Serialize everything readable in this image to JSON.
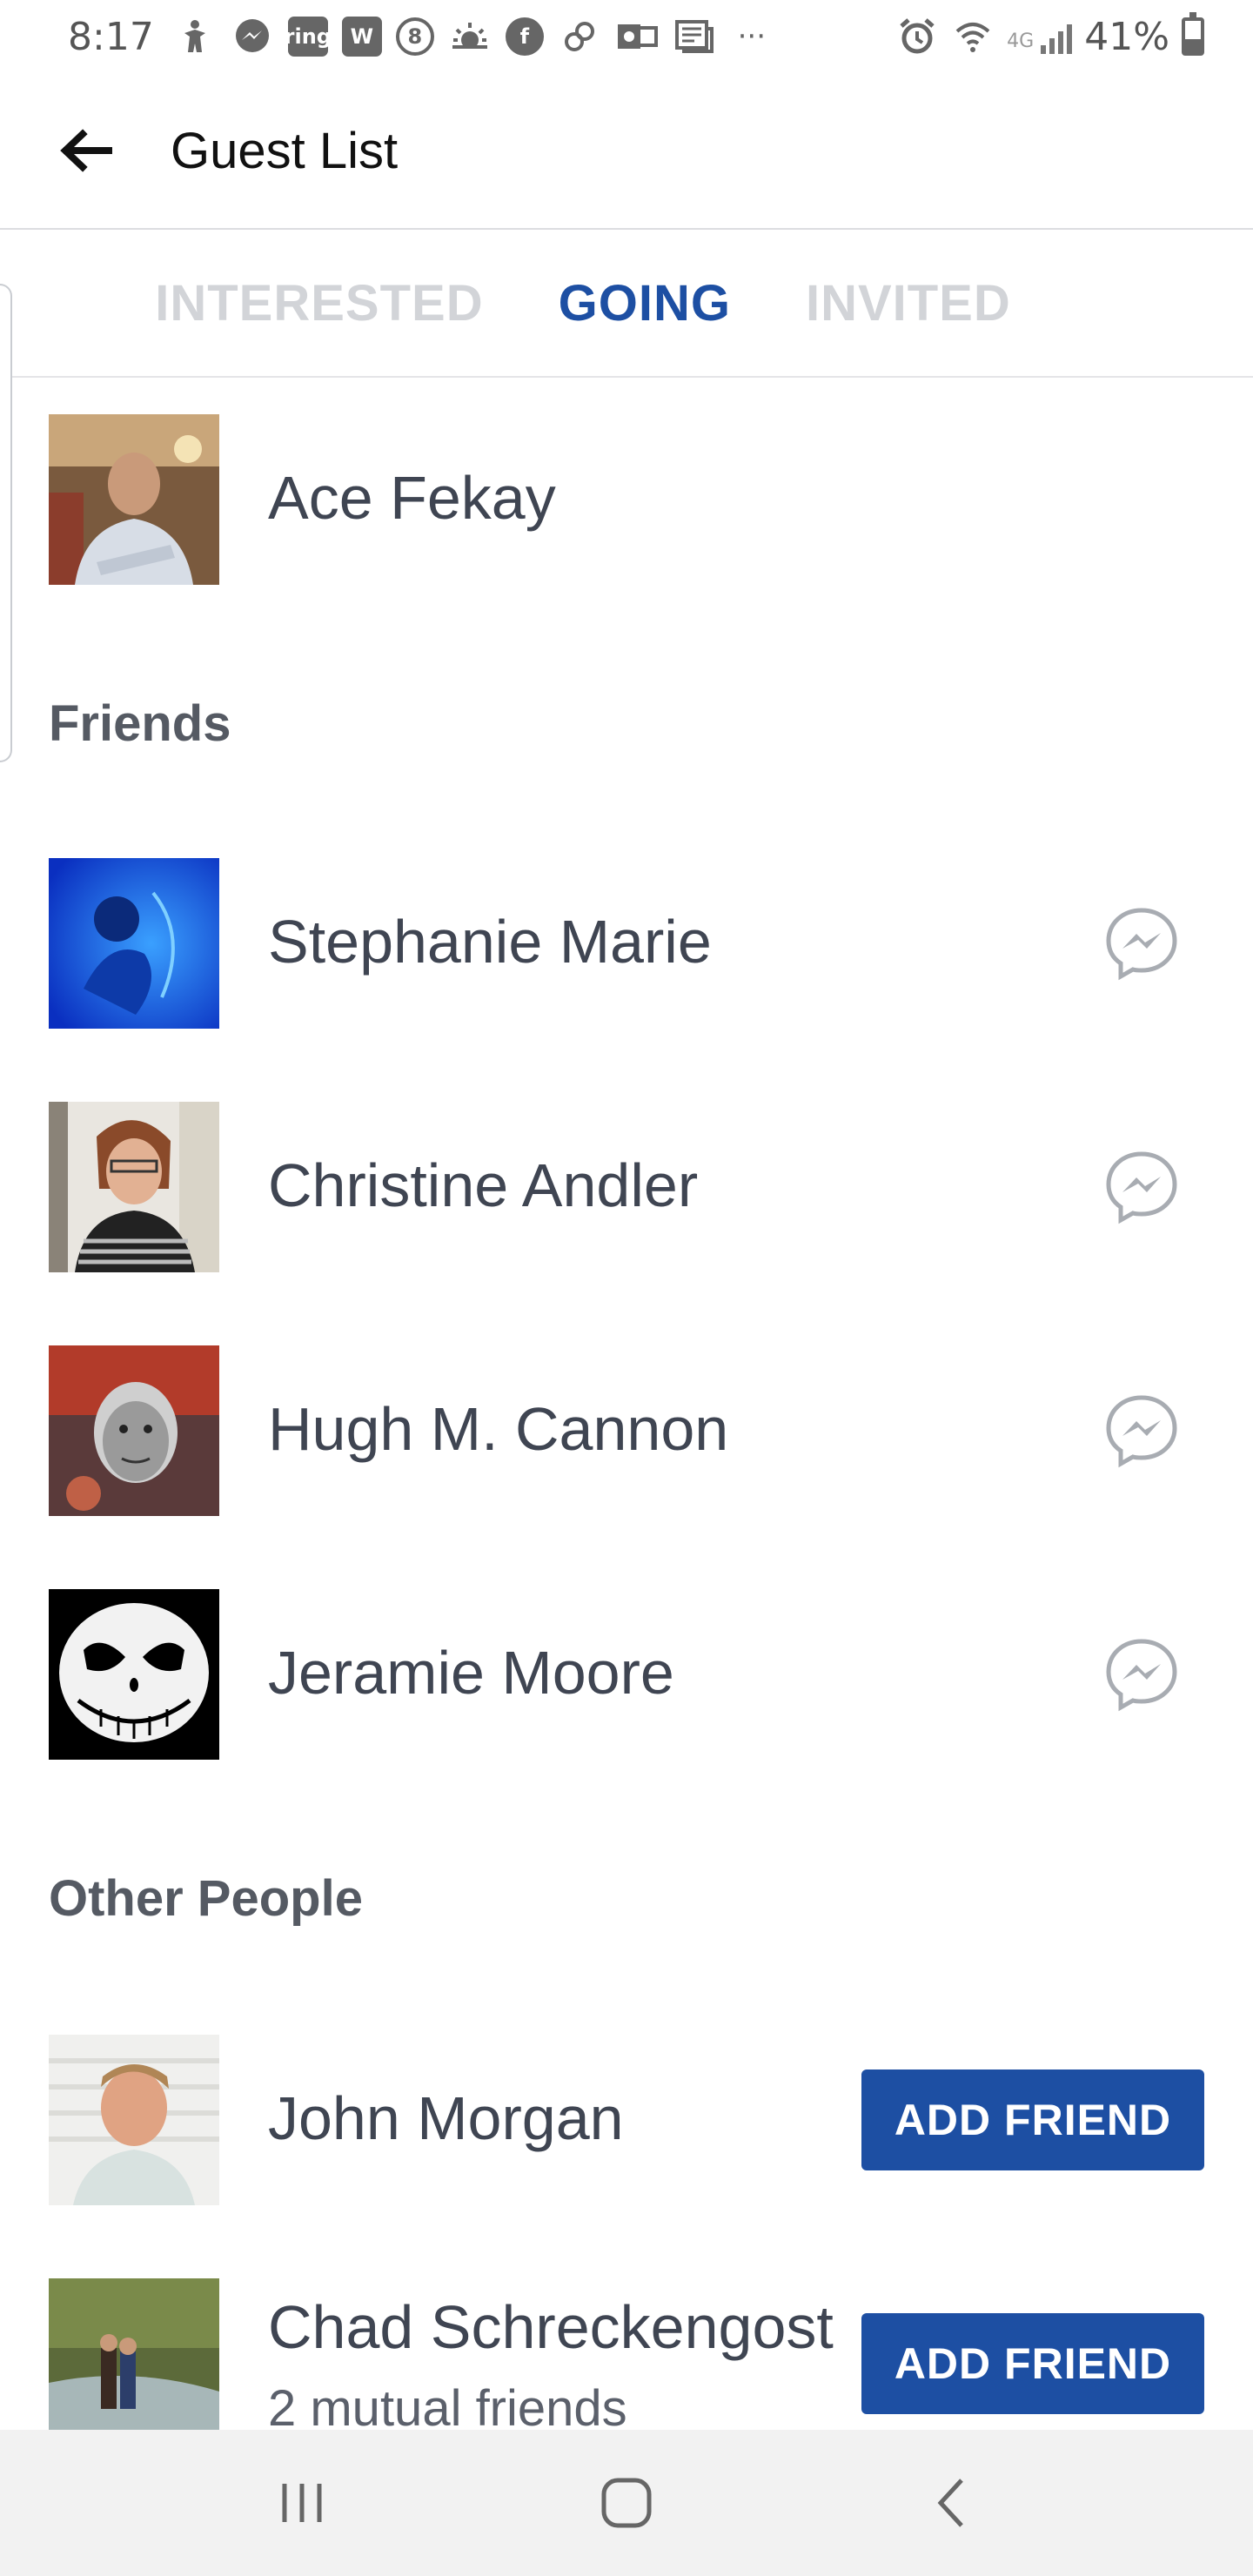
{
  "status_bar": {
    "time": "8:17",
    "icons": [
      "accessibility-icon",
      "messenger-icon",
      "ring-icon",
      "w-app-icon",
      "8-ball-icon",
      "weather-icon",
      "facebook-icon",
      "link-icon",
      "outlook-icon",
      "news-icon",
      "more-dots-icon"
    ],
    "ring_label": "ring",
    "w_label": "W",
    "eight_label": "8",
    "f_label": "f",
    "dots_label": "···",
    "network": "4G",
    "battery": "41%"
  },
  "app_bar": {
    "title": "Guest List",
    "back_icon": "back-arrow-icon"
  },
  "tabs": [
    {
      "label": "INTERESTED",
      "active": false
    },
    {
      "label": "GOING",
      "active": true
    },
    {
      "label": "INVITED",
      "active": false
    }
  ],
  "host": {
    "name": "Ace Fekay"
  },
  "friends_section": {
    "label": "Friends",
    "people": [
      {
        "name": "Stephanie Marie",
        "action_icon": "messenger-icon"
      },
      {
        "name": "Christine Andler",
        "action_icon": "messenger-icon"
      },
      {
        "name": "Hugh M. Cannon",
        "action_icon": "messenger-icon"
      },
      {
        "name": "Jeramie Moore",
        "action_icon": "messenger-icon"
      }
    ]
  },
  "other_section": {
    "label": "Other People",
    "people": [
      {
        "name": "John Morgan",
        "subtitle": "",
        "action_label": "ADD FRIEND"
      },
      {
        "name": "Chad Schreckengost",
        "subtitle": "2 mutual friends",
        "action_label": "ADD FRIEND"
      }
    ]
  },
  "colors": {
    "accent": "#1d4fa3",
    "tab_inactive": "#d2d4d8",
    "text": "#3f4552",
    "nav_bg": "#f2f2f2"
  },
  "nav_bar": {
    "buttons": [
      "recent-apps-icon",
      "home-icon",
      "back-icon"
    ]
  }
}
